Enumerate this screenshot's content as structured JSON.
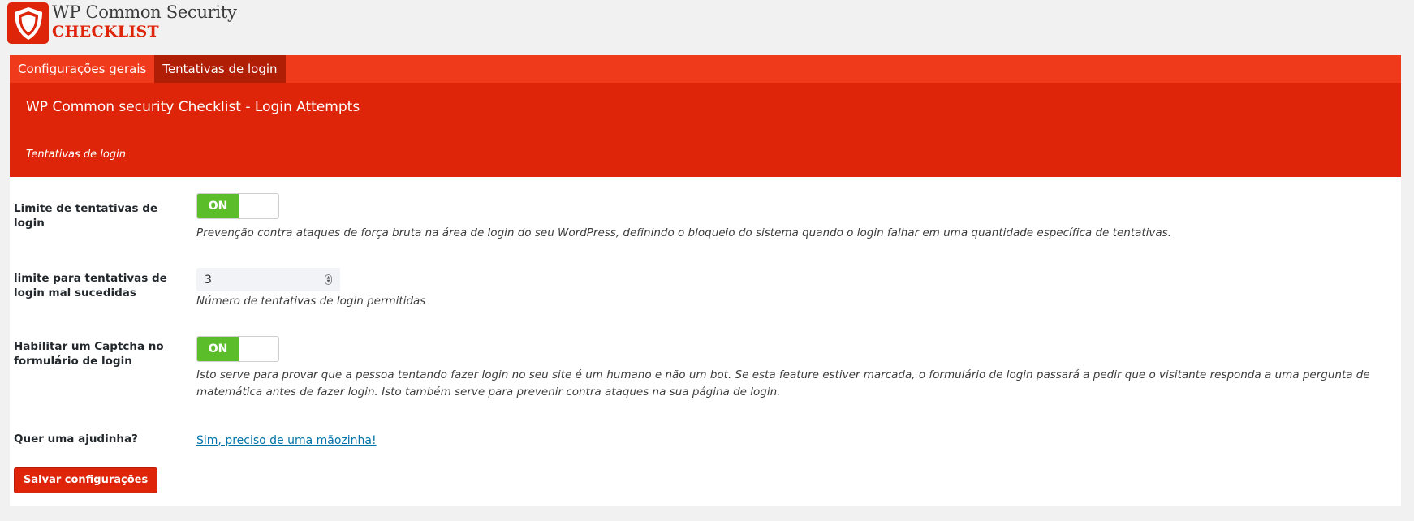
{
  "brand": {
    "title": "WP Common Security",
    "subtitle": "CHECKLIST",
    "color": "#de2409"
  },
  "tabs": [
    {
      "label": "Configurações gerais",
      "active": false
    },
    {
      "label": "Tentativas de login",
      "active": true
    }
  ],
  "hero": {
    "title": "WP Common security Checklist - Login Attempts",
    "subtitle": "Tentativas de login"
  },
  "settings": {
    "limit_attempts": {
      "label": "Limite de tentativas de login",
      "toggle": "ON",
      "description": "Prevenção contra ataques de força bruta na área de login do seu WordPress, definindo o bloqueio do sistema quando o login falhar em uma quantidade específica de tentativas."
    },
    "failed_limit": {
      "label": "limite para tentativas de login mal sucedidas",
      "value": "3",
      "description": "Número de tentativas de login permitidas"
    },
    "captcha": {
      "label": "Habilitar um Captcha no formulário de login",
      "toggle": "ON",
      "description": "Isto serve para provar que a pessoa tentando fazer login no seu site é um humano e não um bot. Se esta feature estiver marcada, o formulário de login passará a pedir que o visitante responda a uma pergunta de matemática antes de fazer login. Isto também serve para prevenir contra ataques na sua página de login."
    },
    "help": {
      "label": "Quer uma ajudinha?",
      "link": "Sim, preciso de uma mãozinha!"
    }
  },
  "actions": {
    "save_label": "Salvar configurações"
  },
  "colors": {
    "tab_bar": "#ef3a1b",
    "tab_active": "#b01e05",
    "hero": "#de2409",
    "toggle_on": "#5cbd2a",
    "link": "#0073aa"
  }
}
